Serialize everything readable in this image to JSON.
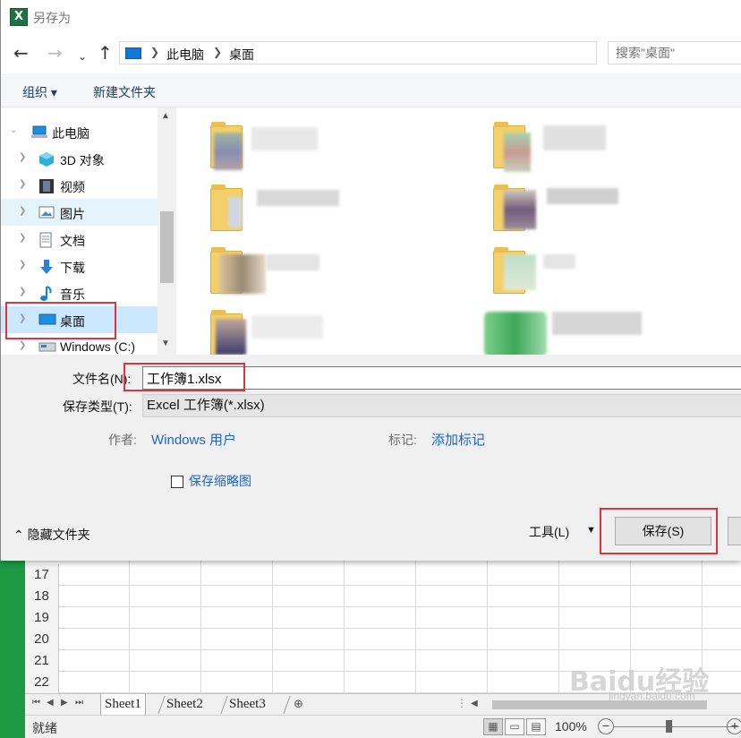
{
  "dialog": {
    "title": "另存为",
    "app_icon_letter": "X"
  },
  "address": {
    "crumbs": [
      "此电脑",
      "桌面"
    ],
    "search_placeholder": "搜索\"桌面\""
  },
  "toolbar": {
    "organize_label": "组织 ▾",
    "new_folder_label": "新建文件夹"
  },
  "nav": {
    "items": [
      {
        "label": "此电脑",
        "icon": "computer-icon"
      },
      {
        "label": "3D 对象",
        "icon": "cube-3d-icon"
      },
      {
        "label": "视频",
        "icon": "film-icon"
      },
      {
        "label": "图片",
        "icon": "picture-icon"
      },
      {
        "label": "文档",
        "icon": "document-icon"
      },
      {
        "label": "下载",
        "icon": "download-arrow-icon"
      },
      {
        "label": "音乐",
        "icon": "music-note-icon"
      },
      {
        "label": "桌面",
        "icon": "desktop-icon",
        "selected": true
      },
      {
        "label": "Windows (C:)",
        "icon": "drive-icon"
      }
    ]
  },
  "fields": {
    "filename_label": "文件名(N):",
    "filename_value": "工作簿1.xlsx",
    "filetype_label": "保存类型(T):",
    "filetype_value": "Excel 工作簿(*.xlsx)",
    "author_label": "作者:",
    "author_value": "Windows 用户",
    "tags_label": "标记:",
    "tags_value": "添加标记",
    "thumbnail_label": "保存缩略图"
  },
  "footer": {
    "hide_folders_label": "隐藏文件夹",
    "tools_label": "工具(L)",
    "save_label": "保存(S)"
  },
  "excel": {
    "row_numbers": [
      "17",
      "18",
      "19",
      "20",
      "21",
      "22"
    ],
    "sheets": [
      "Sheet1",
      "Sheet2",
      "Sheet3"
    ],
    "status_ready": "就绪",
    "zoom": "100%"
  },
  "watermark": {
    "brand": "Baidu经验",
    "url": "jingyan.baidu.com"
  },
  "colors": {
    "accent_link": "#1e64c8",
    "highlight_red": "#e2323a",
    "excel_green": "#1e9a44",
    "selected_bg": "#cce8ff"
  }
}
